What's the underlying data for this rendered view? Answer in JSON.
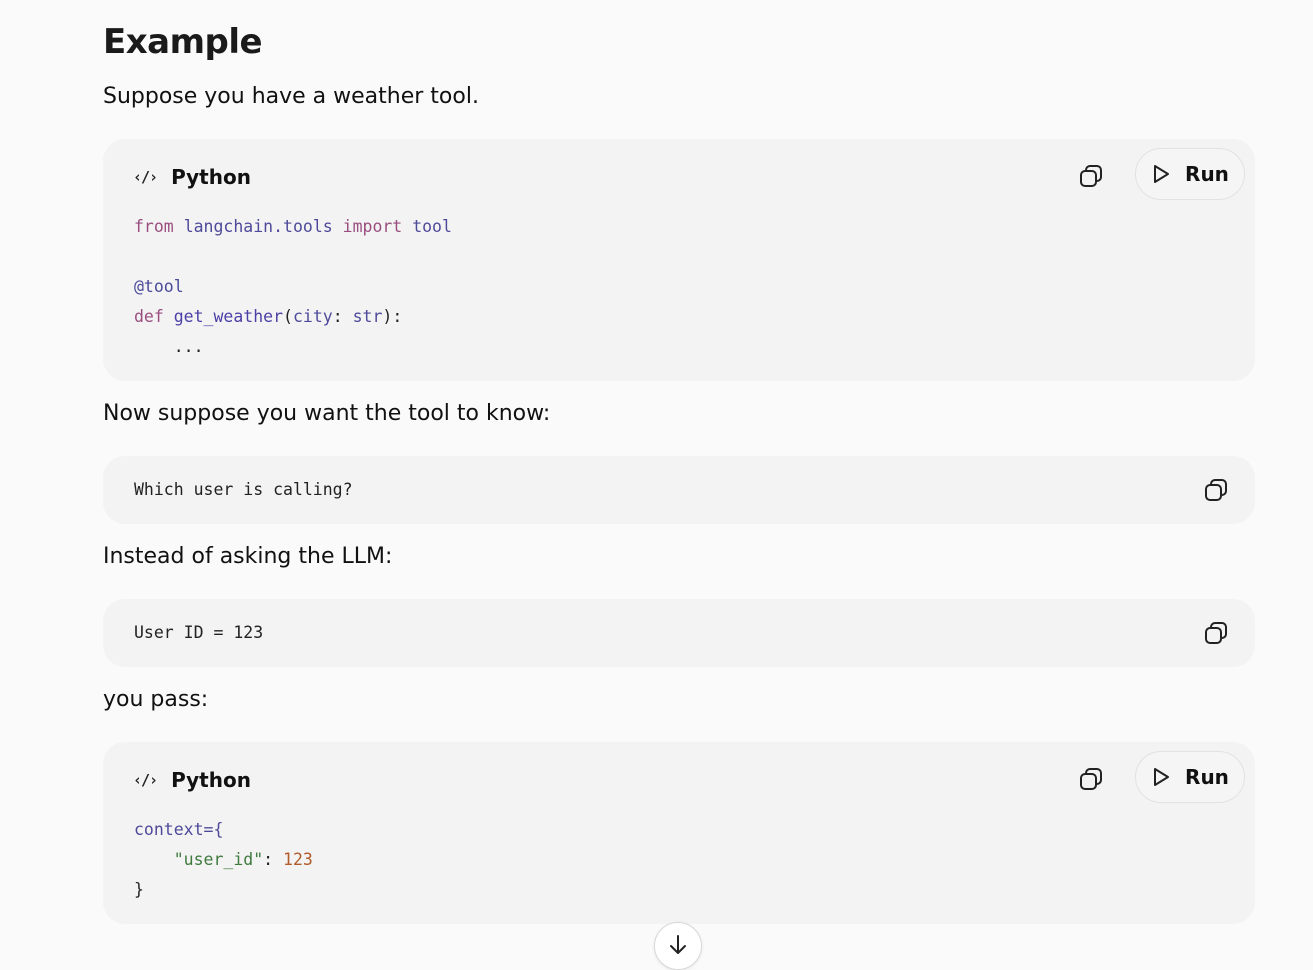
{
  "heading": "Example",
  "intro": "Suppose you have a weather tool.",
  "block1": {
    "language": "Python",
    "run_label": "Run",
    "code": {
      "l1_from": "from",
      "l1_module": "langchain.tools",
      "l1_import": "import",
      "l1_name": "tool",
      "l3_decorator": "@tool",
      "l4_def": "def",
      "l4_fn": "get_weather",
      "l4_paren_open": "(",
      "l4_param": "city",
      "l4_colon": ": ",
      "l4_type": "str",
      "l4_close": "):",
      "l5_body": "    ..."
    }
  },
  "para2": "Now suppose you want the tool to know:",
  "block2": {
    "code": "Which user is calling?"
  },
  "para3": "Instead of asking the LLM:",
  "block3": {
    "code": "User ID = 123"
  },
  "para4": "you pass:",
  "block4": {
    "language": "Python",
    "run_label": "Run",
    "code": {
      "l1_var": "context",
      "l1_eq": "={",
      "l2_indent": "    ",
      "l2_key": "\"user_id\"",
      "l2_colon": ": ",
      "l2_val": "123",
      "l3_close": "}"
    }
  },
  "icons": {
    "code": "code-icon",
    "copy": "copy-icon",
    "play": "play-icon",
    "arrow": "arrow-down-icon"
  }
}
